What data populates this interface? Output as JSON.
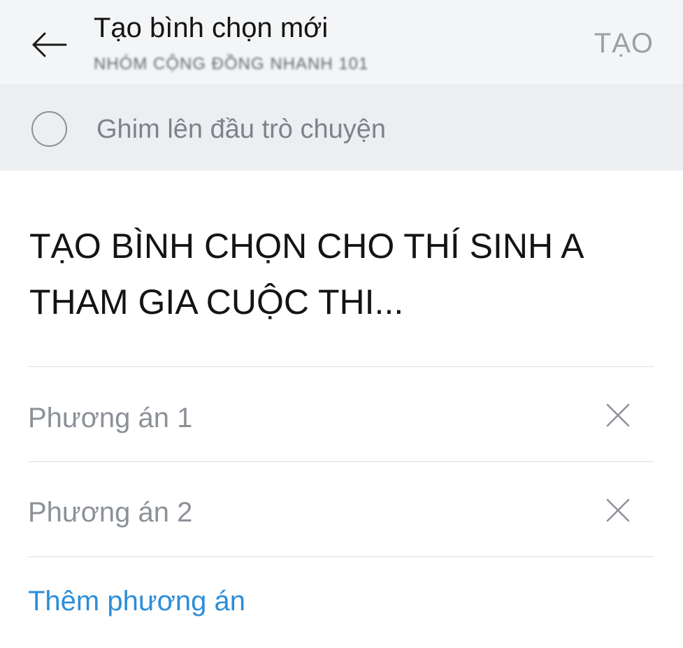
{
  "header": {
    "back_icon": "arrow-left-icon",
    "title": "Tạo bình chọn mới",
    "subtitle": "NHÓM CỘNG ĐỒNG NHANH 101",
    "create_label": "TẠO",
    "create_color": "#9aa0a7"
  },
  "pin": {
    "label": "Ghim lên đầu trò chuyện",
    "checked": false
  },
  "question": {
    "text": "TẠO BÌNH CHỌN CHO THÍ SINH A THAM GIA CUỘC THI..."
  },
  "options": [
    {
      "placeholder": "Phương án 1",
      "value": "",
      "remove_icon": "close-icon"
    },
    {
      "placeholder": "Phương án 2",
      "value": "",
      "remove_icon": "close-icon"
    }
  ],
  "add_option": {
    "label": "Thêm phương án",
    "color": "#2d8ed8"
  }
}
